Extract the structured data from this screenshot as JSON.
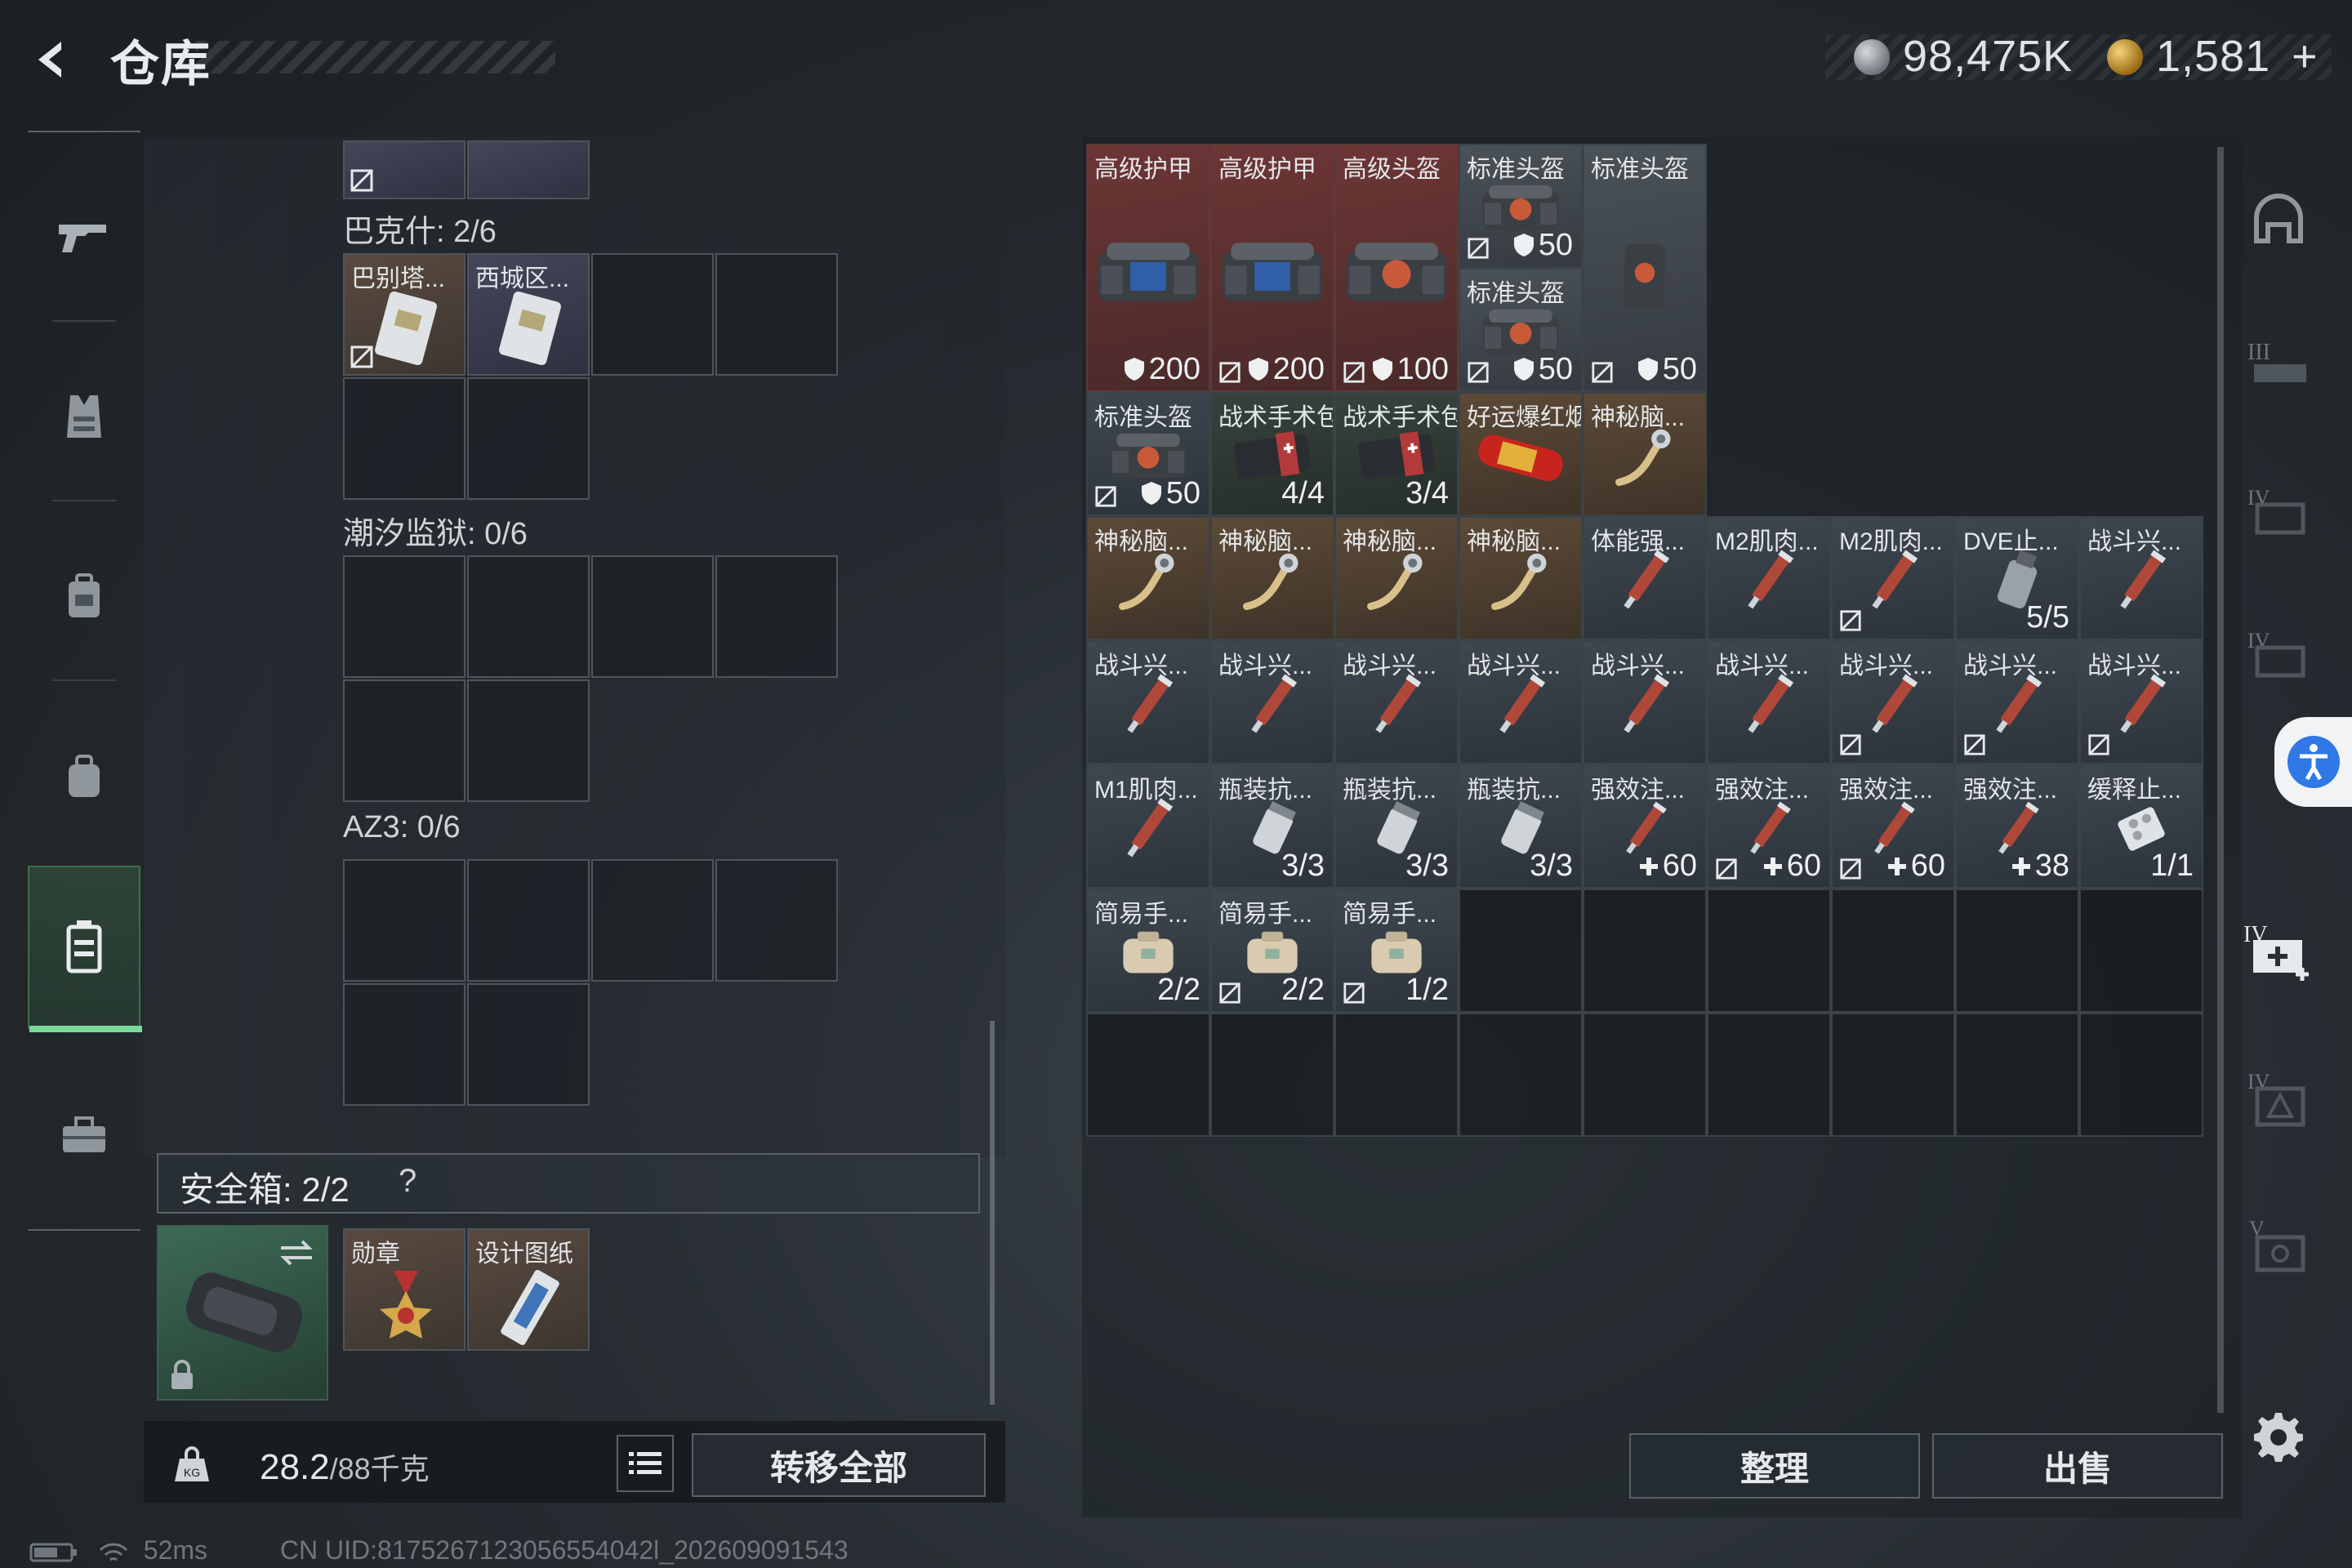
{
  "header": {
    "title": "仓库",
    "currency_silver": "98,475K",
    "currency_gold": "1,581",
    "add_symbol": "+"
  },
  "containers": {
    "bakesh_label": "巴克什: 2/6",
    "bakesh_items": [
      "巴别塔...",
      "西城区..."
    ],
    "tidal_label": "潮汐监狱: 0/6",
    "az3_label": "AZ3: 0/6"
  },
  "safebox": {
    "label": "安全箱: 2/2",
    "help": "?",
    "items": [
      "勋章",
      "设计图纸"
    ]
  },
  "weight": {
    "value": "28.2",
    "max": "/88千克"
  },
  "buttons": {
    "transfer_all": "转移全部",
    "sort": "整理",
    "sell": "出售"
  },
  "status": {
    "ping": "52ms",
    "uid": "CN UID:8175267123056554042l_202609091543"
  },
  "warehouse": {
    "items": [
      {
        "name": "高级护甲",
        "value": "200",
        "icon": "armor-bag"
      },
      {
        "name": "高级护甲",
        "value": "200",
        "icon": "armor-bag"
      },
      {
        "name": "高级头盔",
        "value": "100",
        "icon": "helmet-bag"
      },
      {
        "name": "标准头盔",
        "value": "50",
        "icon": "helmet-bag"
      },
      {
        "name": "标准头盔",
        "value": "50",
        "icon": "helmet-bag"
      },
      {
        "name": "标准头盔",
        "value": "50",
        "icon": "helmet-vest"
      },
      {
        "name": "标准头盔",
        "value": "50",
        "icon": "helmet-bag"
      },
      {
        "name": "战术手术包",
        "value": "4/4",
        "icon": "surgery-kit"
      },
      {
        "name": "战术手术包",
        "value": "3/4",
        "icon": "surgery-kit"
      },
      {
        "name": "好运爆红烟花",
        "value": "",
        "icon": "firework"
      },
      {
        "name": "神秘脑...",
        "value": "",
        "icon": "brain"
      },
      {
        "name": "神秘脑...",
        "value": "",
        "icon": "brain"
      },
      {
        "name": "神秘脑...",
        "value": "",
        "icon": "brain"
      },
      {
        "name": "神秘脑...",
        "value": "",
        "icon": "brain"
      },
      {
        "name": "神秘脑...",
        "value": "",
        "icon": "brain"
      },
      {
        "name": "体能强...",
        "value": "",
        "icon": "syringe"
      },
      {
        "name": "M2肌肉...",
        "value": "",
        "icon": "syringe"
      },
      {
        "name": "M2肌肉...",
        "value": "",
        "icon": "syringe"
      },
      {
        "name": "DVE止...",
        "value": "5/5",
        "icon": "spray"
      },
      {
        "name": "战斗兴...",
        "value": "",
        "icon": "syringe"
      },
      {
        "name": "M1肌肉...",
        "value": "",
        "icon": "syringe"
      },
      {
        "name": "瓶装抗...",
        "value": "3/3",
        "icon": "bottle"
      },
      {
        "name": "瓶装抗...",
        "value": "3/3",
        "icon": "bottle"
      },
      {
        "name": "瓶装抗...",
        "value": "3/3",
        "icon": "bottle"
      },
      {
        "name": "强效注...",
        "value": "60",
        "icon": "syringe"
      },
      {
        "name": "强效注...",
        "value": "60",
        "icon": "syringe"
      },
      {
        "name": "强效注...",
        "value": "60",
        "icon": "syringe"
      },
      {
        "name": "强效注...",
        "value": "38",
        "icon": "syringe"
      },
      {
        "name": "缓释止...",
        "value": "1/1",
        "icon": "pills"
      },
      {
        "name": "简易手...",
        "value": "2/2",
        "icon": "bandage-pouch"
      },
      {
        "name": "简易手...",
        "value": "2/2",
        "icon": "bandage-pouch"
      },
      {
        "name": "简易手...",
        "value": "1/2",
        "icon": "bandage-pouch"
      }
    ],
    "combat_label": "战斗兴..."
  }
}
